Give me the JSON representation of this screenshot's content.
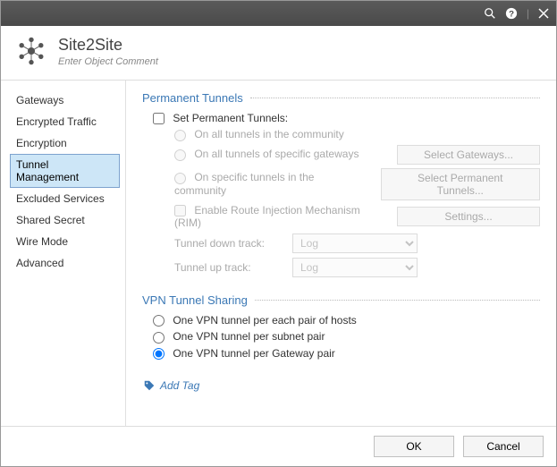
{
  "header": {
    "title": "Site2Site",
    "subtitle": "Enter Object Comment"
  },
  "sidebar": {
    "items": [
      "Gateways",
      "Encrypted Traffic",
      "Encryption",
      "Tunnel Management",
      "Excluded Services",
      "Shared Secret",
      "Wire Mode",
      "Advanced"
    ],
    "selected_index": 3
  },
  "permanent": {
    "section_title": "Permanent Tunnels",
    "set_label": "Set Permanent Tunnels:",
    "opt_all": "On all tunnels in the community",
    "opt_gateways": "On all tunnels of specific gateways",
    "opt_specific": "On specific tunnels in the community",
    "opt_rim": "Enable Route Injection Mechanism (RIM)",
    "btn_gateways": "Select Gateways...",
    "btn_specific": "Select Permanent Tunnels...",
    "btn_settings": "Settings...",
    "track_down_label": "Tunnel down track:",
    "track_up_label": "Tunnel up track:",
    "track_value": "Log"
  },
  "sharing": {
    "section_title": "VPN Tunnel Sharing",
    "opt_hosts": "One VPN tunnel per each pair of hosts",
    "opt_subnet": "One VPN tunnel per subnet pair",
    "opt_gateway": "One VPN tunnel per Gateway pair",
    "selected": "gateway"
  },
  "addtag_label": "Add Tag",
  "footer": {
    "ok": "OK",
    "cancel": "Cancel"
  }
}
